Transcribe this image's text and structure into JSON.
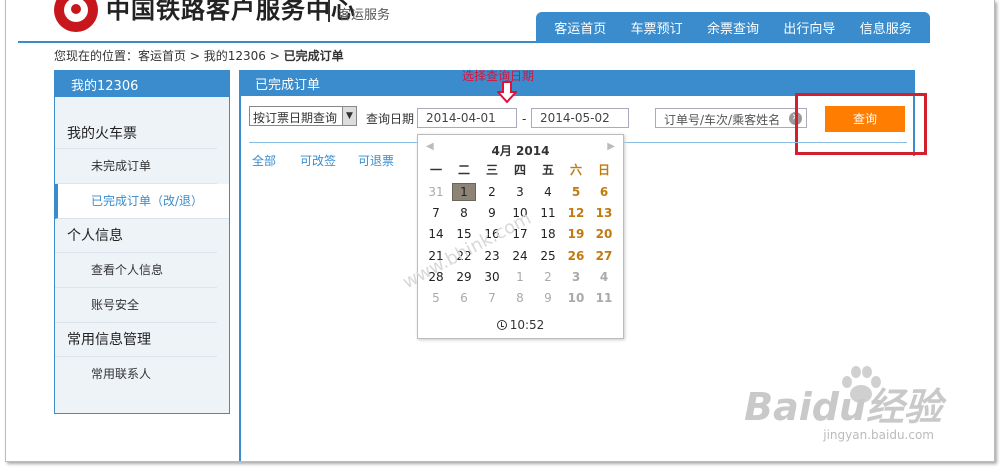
{
  "header": {
    "site_title": "中国铁路客户服务中心",
    "site_sub": "客运服务",
    "nav": [
      "客运首页",
      "车票预订",
      "余票查询",
      "出行向导",
      "信息服务"
    ]
  },
  "breadcrumb": {
    "prefix": "您现在的位置：",
    "home": "客运首页",
    "sep1": " > ",
    "mine": "我的12306",
    "sep2": " > ",
    "current": "已完成订单"
  },
  "sidebar": {
    "title": "我的12306",
    "group_tickets": "我的火车票",
    "pending_orders": "未完成订单",
    "completed_orders": "已完成订单（改/退）",
    "group_personal": "个人信息",
    "view_info": "查看个人信息",
    "account_security": "账号安全",
    "group_common": "常用信息管理",
    "contacts": "常用联系人"
  },
  "panel": {
    "title": "已完成订单",
    "query_type": "按订票日期查询",
    "date_label": "查询日期",
    "date_from": "2014-04-01",
    "dash": "-",
    "date_to": "2014-05-02",
    "order_placeholder": "订单号/车次/乘客姓名",
    "query_button": "查询",
    "filters": [
      "全部",
      "可改签",
      "可退票"
    ]
  },
  "annotation": "选择查询日期",
  "calendar": {
    "title": "4月 2014",
    "weekdays": [
      "一",
      "二",
      "三",
      "四",
      "五",
      "六",
      "日"
    ],
    "days": [
      "31",
      "1",
      "2",
      "3",
      "4",
      "5",
      "6",
      "7",
      "8",
      "9",
      "10",
      "11",
      "12",
      "13",
      "14",
      "15",
      "16",
      "17",
      "18",
      "19",
      "20",
      "21",
      "22",
      "23",
      "24",
      "25",
      "26",
      "27",
      "28",
      "29",
      "30",
      "1",
      "2",
      "3",
      "4",
      "5",
      "6",
      "7",
      "8",
      "9",
      "10",
      "11"
    ],
    "selected_day": "1",
    "time": "10:52"
  },
  "watermark": {
    "brand": "Baidu经验",
    "url": "jingyan.baidu.com",
    "diagonal": "www.bhink.com"
  },
  "colors": {
    "primary_blue": "#3a8ccc",
    "query_orange": "#ff7d00",
    "highlight_red": "#d4202c",
    "weekend_gold": "#c07a10"
  }
}
